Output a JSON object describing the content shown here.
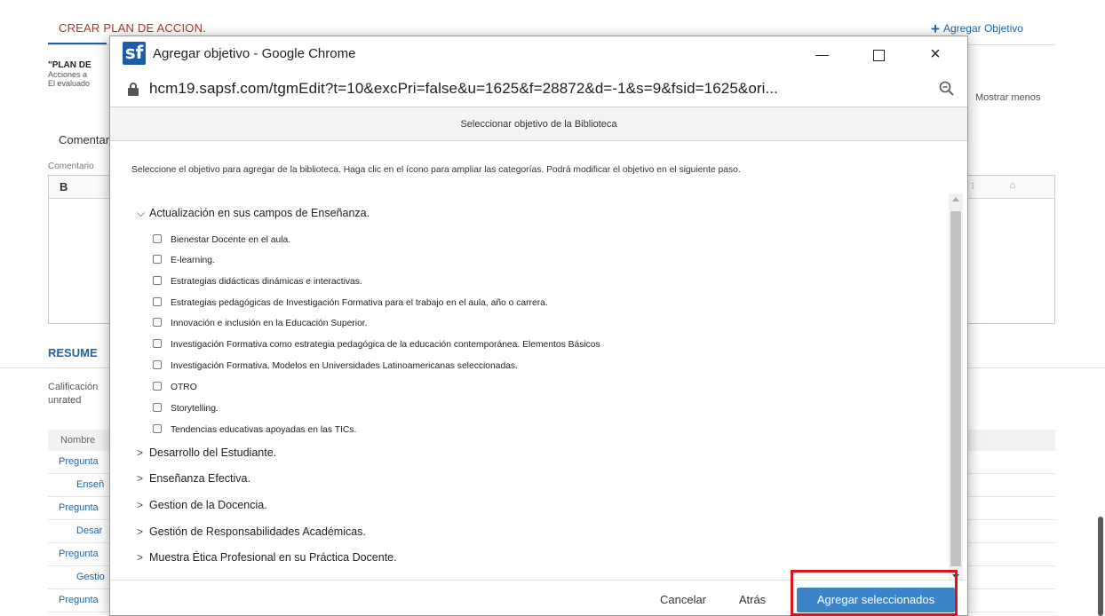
{
  "background": {
    "title": "CREAR PLAN DE ACCION.",
    "add_objective": "Agregar Objetivo",
    "plan_label": "\"PLAN DE",
    "line1": "Acciones a",
    "line2": "El evaluado",
    "show_less": "Mostrar menos",
    "comments_heading": "Comentari",
    "comments_label": "Comentario",
    "editor_bold": "B",
    "summary_heading": "RESUME",
    "rating_label": "Calificación",
    "rating_value": "unrated",
    "table_header": "Nombre",
    "rows": [
      "Pregunta",
      "Enseñ",
      "Pregunta",
      "Desar",
      "Pregunta",
      "Gestio",
      "Pregunta"
    ]
  },
  "window": {
    "title": "Agregar objetivo - Google Chrome",
    "logo_text": "sf",
    "url": "hcm19.sapsf.com/tgmEdit?t=10&excPri=false&u=1625&f=28872&d=-1&s=9&fsid=1625&ori...",
    "minimize": "minimize-icon",
    "maximize": "maximize-icon",
    "close": "×"
  },
  "dialog": {
    "header": "Seleccionar objetivo de la Biblioteca",
    "instructions": "Seleccione el objetivo para agregar de la biblioteca. Haga clic en el ícono para ampliar las categorías. Podrá modificar el objetivo en el siguiente paso.",
    "categories": [
      {
        "label": "Actualización en sus campos de Enseñanza.",
        "expanded": true,
        "items": [
          "Bienestar Docente en el aula.",
          "E-learning.",
          "Estrategias didácticas dinámicas e interactivas.",
          "Estrategias pedagógicas de Investigación Formativa para el trabajo en el aula, año o carrera.",
          "Innovación e inclusión en la Educación Superior.",
          "Investigación Formativa como estrategia pedagógica de la educación contemporánea. Elementos Básicos",
          "Investigación Formativa. Modelos en Universidades Latinoamericanas seleccionadas.",
          "OTRO",
          "Storytelling.",
          "Tendencias educativas apoyadas en las TICs."
        ]
      },
      {
        "label": "Desarrollo del Estudiante.",
        "expanded": false
      },
      {
        "label": "Enseñanza Efectiva.",
        "expanded": false
      },
      {
        "label": "Gestion de la Docencia.",
        "expanded": false
      },
      {
        "label": "Gestión de Responsabilidades Académicas.",
        "expanded": false
      },
      {
        "label": "Muestra Ética Profesional en su Práctica Docente.",
        "expanded": false
      }
    ],
    "buttons": {
      "cancel": "Cancelar",
      "back": "Atrás",
      "add_selected": "Agregar seleccionados"
    }
  },
  "colors": {
    "accent": "#3c84c8",
    "highlight": "#e0101a",
    "title_red": "#a63a2a",
    "link_blue": "#1c65a8"
  }
}
